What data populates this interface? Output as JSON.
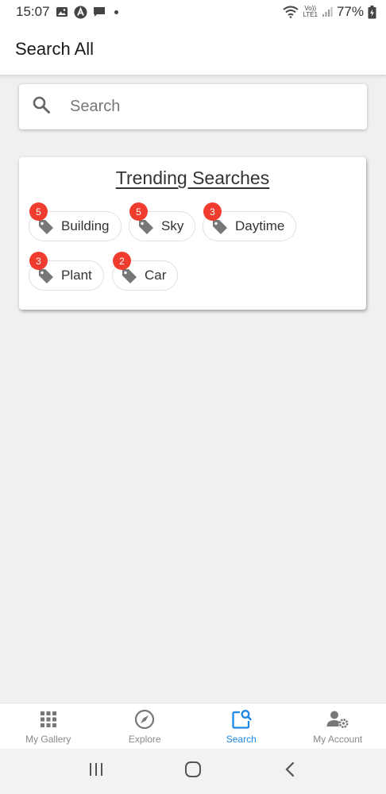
{
  "status_bar": {
    "time": "15:07",
    "battery": "77%",
    "network_top": "Vo))",
    "network_bottom": "LTE1"
  },
  "app_bar": {
    "title": "Search All"
  },
  "search": {
    "placeholder": "Search",
    "value": ""
  },
  "trending": {
    "title": "Trending Searches",
    "items": [
      {
        "label": "Building",
        "count": "5"
      },
      {
        "label": "Sky",
        "count": "5"
      },
      {
        "label": "Daytime",
        "count": "3"
      },
      {
        "label": "Plant",
        "count": "3"
      },
      {
        "label": "Car",
        "count": "2"
      }
    ]
  },
  "bottom_nav": {
    "items": [
      {
        "label": "My Gallery",
        "icon": "grid-icon",
        "active": false
      },
      {
        "label": "Explore",
        "icon": "compass-icon",
        "active": false
      },
      {
        "label": "Search",
        "icon": "image-search-icon",
        "active": true
      },
      {
        "label": "My Account",
        "icon": "account-settings-icon",
        "active": false
      }
    ]
  },
  "colors": {
    "accent": "#1e88e5",
    "badge": "#f03c2e",
    "icon_gray": "#777777"
  }
}
